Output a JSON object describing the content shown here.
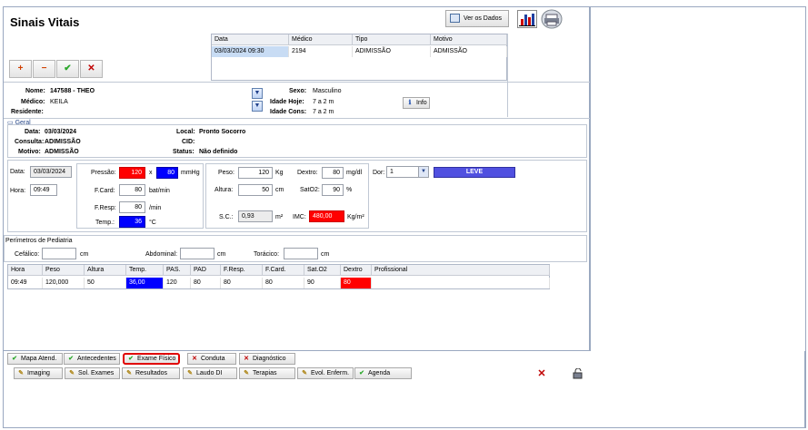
{
  "page_title": "Sinais Vitais",
  "toolbar": {
    "view_data_label": "Ver os Dados",
    "add": "+",
    "remove": "−",
    "confirm": "✔",
    "cancel": "✕"
  },
  "consult_grid": {
    "headers": [
      "Data",
      "Médico",
      "Tipo",
      "Motivo"
    ],
    "rows": [
      [
        "03/03/2024 09:30",
        "2194",
        "ADIMISSÃO",
        "ADMISSÃO"
      ]
    ]
  },
  "patient": {
    "name_label": "Nome:",
    "name_value": "147588 - THEO",
    "doctor_label": "Médico:",
    "doctor_value": "KEILA",
    "resident_label": "Residente:",
    "resident_value": "",
    "sex_label": "Sexo:",
    "sex_value": "Masculino",
    "age_today_label": "Idade Hoje:",
    "age_today_value": "7 a 2 m",
    "age_cons_label": "Idade Cons:",
    "age_cons_value": "7 a 2 m",
    "info_label": "Info"
  },
  "geral": {
    "section_label": "Geral",
    "date_label": "Data:",
    "date_value": "03/03/2024",
    "consulta_label": "Consulta:",
    "consulta_value": "ADIMISSÃO",
    "motivo_label": "Motivo:",
    "motivo_value": "ADMISSÃO",
    "local_label": "Local:",
    "local_value": "Pronto Socorro",
    "cid_label": "CID:",
    "cid_value": "",
    "status_label": "Status:",
    "status_value": "Não definido"
  },
  "vitals": {
    "date_label": "Data:",
    "date_value": "03/03/2024",
    "time_label": "Hora:",
    "time_value": "09:49",
    "pressure_label": "Pressão:",
    "pressure_sys": "120",
    "pressure_x": "x",
    "pressure_dia": "80",
    "pressure_unit": "mmHg",
    "fcard_label": "F.Card:",
    "fcard_value": "80",
    "fcard_unit": "bat/min",
    "fresp_label": "F.Resp:",
    "fresp_value": "80",
    "fresp_unit": "/min",
    "temp_label": "Temp.:",
    "temp_value": "36",
    "temp_unit": "°C",
    "weight_label": "Peso:",
    "weight_value": "120",
    "weight_unit": "Kg",
    "height_label": "Altura:",
    "height_value": "50",
    "height_unit": "cm",
    "sc_label": "S.C.:",
    "sc_value": "0,93",
    "sc_unit": "m²",
    "dextro_label": "Dextro:",
    "dextro_value": "80",
    "dextro_unit": "mg/dl",
    "sato2_label": "SatO2:",
    "sato2_value": "90",
    "sato2_unit": "%",
    "imc_label": "IMC:",
    "imc_value": "480,00",
    "imc_unit": "Kg/m²",
    "pain_label": "Dor:",
    "pain_value": "1",
    "pain_level": "LEVE"
  },
  "perimetros": {
    "section_label": "Perímetros de Pediatria",
    "cefalico_label": "Cefálico:",
    "cefalico_unit": "cm",
    "abdominal_label": "Abdominal:",
    "abdominal_unit": "cm",
    "toracico_label": "Torácico:",
    "toracico_unit": "cm"
  },
  "history_grid": {
    "headers": [
      "Hora",
      "Peso",
      "Altura",
      "Temp.",
      "PAS.",
      "PAD",
      "F.Resp.",
      "F.Card.",
      "Sat.O2",
      "Dextro",
      "Profissional"
    ],
    "rows": [
      [
        "09:49",
        "120,000",
        "50",
        "36,00",
        "120",
        "80",
        "80",
        "80",
        "90",
        "80",
        ""
      ]
    ]
  },
  "bottom_tabs_row1": [
    "Mapa Atend.",
    "Antecedentes",
    "Exame Físico",
    "Conduta",
    "Diagnóstico"
  ],
  "bottom_tabs_row2": [
    "Imaging",
    "Sol. Exames",
    "Resultados",
    "Laudo DI",
    "Terapias",
    "Evol. Enferm.",
    "Agenda"
  ],
  "colors": {
    "alert_red": "#ff0000",
    "alert_blue": "#0000ff",
    "pain_bar": "#5050e0",
    "highlight_ring": "#e00000"
  }
}
